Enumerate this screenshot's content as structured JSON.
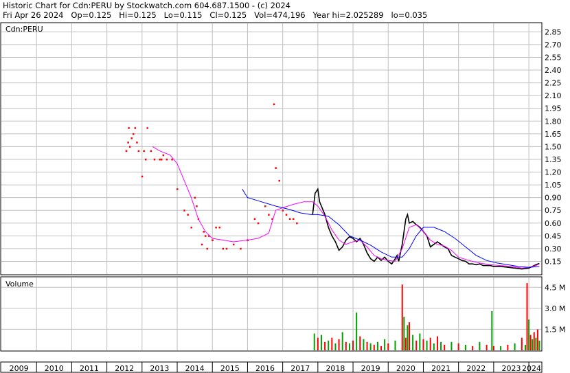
{
  "header": {
    "title": "Historic Chart for Cdn:PERU by Stockwatch.com 604.687.1500 - (c) 2024",
    "info": "Fri Apr 26 2024   Op=0.125   Hi=0.125   Lo=0.115   Cl=0.125   Vol=474,196   Year hi=2.025289   lo=0.035"
  },
  "chart_data": [
    {
      "type": "line",
      "panel": "price",
      "title": "Cdn:PERU",
      "y_tick_labels": [
        "2.85",
        "2.70",
        "2.55",
        "2.40",
        "2.25",
        "2.10",
        "1.95",
        "1.80",
        "1.65",
        "1.50",
        "1.35",
        "1.20",
        "1.05",
        "0.90",
        "0.75",
        "0.60",
        "0.45",
        "0.30",
        "0.15"
      ],
      "ylim": [
        0,
        2.95
      ],
      "xlim": [
        2009.0,
        2024.35
      ],
      "grid": true,
      "colors": {
        "price": "#000000",
        "close_dot": "#ff0000",
        "ma_short": "#ff00ff",
        "ma_long": "#0000ff",
        "grid": "#c0c0c0"
      },
      "series": [
        {
          "role": "price",
          "x": [
            2017.85,
            2017.92,
            2018.0,
            2018.05,
            2018.1,
            2018.2,
            2018.3,
            2018.4,
            2018.5,
            2018.6,
            2018.7,
            2018.8,
            2018.9,
            2019.0,
            2019.1,
            2019.2,
            2019.3,
            2019.4,
            2019.5,
            2019.6,
            2019.7,
            2019.8,
            2019.9,
            2020.0,
            2020.1,
            2020.2,
            2020.25,
            2020.3,
            2020.4,
            2020.5,
            2020.55,
            2020.6,
            2020.7,
            2020.8,
            2020.9,
            2021.0,
            2021.1,
            2021.2,
            2021.3,
            2021.4,
            2021.5,
            2021.6,
            2021.7,
            2021.8,
            2021.9,
            2022.0,
            2022.1,
            2022.2,
            2022.3,
            2022.4,
            2022.5,
            2022.6,
            2022.7,
            2022.8,
            2022.9,
            2023.0,
            2023.2,
            2023.4,
            2023.6,
            2023.8,
            2024.0,
            2024.1,
            2024.2,
            2024.3
          ],
          "y": [
            0.7,
            0.95,
            1.0,
            0.85,
            0.8,
            0.7,
            0.55,
            0.45,
            0.38,
            0.28,
            0.32,
            0.4,
            0.44,
            0.42,
            0.38,
            0.42,
            0.35,
            0.25,
            0.18,
            0.15,
            0.2,
            0.16,
            0.2,
            0.15,
            0.12,
            0.18,
            0.22,
            0.15,
            0.35,
            0.65,
            0.7,
            0.6,
            0.62,
            0.58,
            0.55,
            0.5,
            0.45,
            0.32,
            0.35,
            0.38,
            0.35,
            0.32,
            0.3,
            0.22,
            0.2,
            0.18,
            0.16,
            0.15,
            0.12,
            0.12,
            0.11,
            0.12,
            0.1,
            0.1,
            0.1,
            0.09,
            0.09,
            0.08,
            0.07,
            0.06,
            0.07,
            0.09,
            0.11,
            0.125
          ]
        },
        {
          "role": "close_dots",
          "x": [
            2012.55,
            2012.6,
            2012.62,
            2012.65,
            2012.7,
            2012.75,
            2012.8,
            2012.85,
            2012.9,
            2013.0,
            2013.05,
            2013.1,
            2013.15,
            2013.25,
            2013.35,
            2013.5,
            2013.55,
            2013.6,
            2013.7,
            2013.85,
            2014.0,
            2014.2,
            2014.3,
            2014.4,
            2014.5,
            2014.55,
            2014.6,
            2014.7,
            2014.75,
            2014.8,
            2014.85,
            2014.9,
            2015.0,
            2015.1,
            2015.2,
            2015.3,
            2015.4,
            2015.6,
            2015.8,
            2016.0,
            2016.2,
            2016.3,
            2016.5,
            2016.6,
            2016.7,
            2016.75,
            2016.8,
            2016.9,
            2017.0,
            2017.1,
            2017.2,
            2017.3,
            2017.4
          ],
          "y": [
            1.45,
            1.55,
            1.72,
            1.5,
            1.6,
            1.65,
            1.72,
            1.55,
            1.45,
            1.15,
            1.45,
            1.35,
            1.72,
            1.45,
            1.35,
            1.35,
            1.35,
            1.4,
            1.35,
            1.35,
            1.0,
            0.75,
            0.7,
            0.55,
            0.9,
            0.8,
            0.65,
            0.35,
            0.5,
            0.45,
            0.3,
            0.45,
            0.4,
            0.55,
            0.55,
            0.3,
            0.3,
            0.35,
            0.3,
            0.4,
            0.65,
            0.6,
            0.8,
            0.7,
            0.65,
            2.0,
            1.25,
            1.1,
            0.75,
            0.7,
            0.65,
            0.65,
            0.6
          ]
        },
        {
          "role": "ma_short",
          "x": [
            2013.3,
            2013.5,
            2013.8,
            2014.0,
            2014.2,
            2014.4,
            2014.6,
            2014.8,
            2015.0,
            2015.3,
            2015.6,
            2016.0,
            2016.3,
            2016.6,
            2016.8,
            2017.0,
            2017.3,
            2017.6,
            2017.85,
            2018.0,
            2018.2,
            2018.4,
            2018.6,
            2018.8,
            2019.0,
            2019.2,
            2019.4,
            2019.6,
            2019.8,
            2020.0,
            2020.2,
            2020.4,
            2020.6,
            2020.8,
            2021.0,
            2021.2,
            2021.4,
            2021.6,
            2021.8,
            2022.0,
            2022.3,
            2022.6,
            2022.9,
            2023.2,
            2023.5,
            2023.8,
            2024.0,
            2024.2,
            2024.3
          ],
          "y": [
            1.5,
            1.45,
            1.4,
            1.3,
            1.1,
            0.9,
            0.65,
            0.5,
            0.42,
            0.4,
            0.38,
            0.4,
            0.42,
            0.48,
            0.75,
            0.78,
            0.82,
            0.85,
            0.85,
            0.8,
            0.68,
            0.52,
            0.4,
            0.35,
            0.38,
            0.4,
            0.32,
            0.22,
            0.18,
            0.16,
            0.15,
            0.3,
            0.55,
            0.58,
            0.5,
            0.4,
            0.35,
            0.33,
            0.28,
            0.2,
            0.16,
            0.13,
            0.11,
            0.1,
            0.09,
            0.07,
            0.08,
            0.1,
            0.12
          ]
        },
        {
          "role": "ma_long",
          "x": [
            2015.85,
            2016.0,
            2016.4,
            2016.8,
            2017.2,
            2017.5,
            2017.8,
            2018.0,
            2018.3,
            2018.6,
            2018.9,
            2019.2,
            2019.5,
            2019.8,
            2020.1,
            2020.4,
            2020.6,
            2020.8,
            2021.0,
            2021.3,
            2021.6,
            2021.9,
            2022.2,
            2022.5,
            2022.8,
            2023.1,
            2023.4,
            2023.7,
            2024.0,
            2024.3
          ],
          "y": [
            1.0,
            0.9,
            0.85,
            0.8,
            0.76,
            0.72,
            0.7,
            0.7,
            0.68,
            0.58,
            0.45,
            0.4,
            0.34,
            0.26,
            0.2,
            0.2,
            0.3,
            0.45,
            0.55,
            0.55,
            0.5,
            0.42,
            0.32,
            0.22,
            0.16,
            0.13,
            0.11,
            0.09,
            0.08,
            0.09
          ]
        }
      ]
    },
    {
      "type": "bar",
      "panel": "volume",
      "title": "Volume",
      "y_tick_labels": [
        "4.5 M",
        "3.0 M",
        "1.5 M"
      ],
      "ylim": [
        0,
        5.2
      ],
      "xlim": [
        2009.0,
        2024.35
      ],
      "x_tick_labels": [
        "2009",
        "2010",
        "2011",
        "2012",
        "2013",
        "2014",
        "2015",
        "2016",
        "2017",
        "2018",
        "2019",
        "2020",
        "2021",
        "2022",
        "2023",
        "2024"
      ],
      "colors": {
        "up": "#00a000",
        "down": "#ff0000",
        "neutral": "#909090"
      },
      "series": [
        {
          "name": "Volume",
          "x": [
            2017.9,
            2018.0,
            2018.1,
            2018.2,
            2018.3,
            2018.4,
            2018.5,
            2018.6,
            2018.7,
            2018.8,
            2018.9,
            2019.0,
            2019.1,
            2019.2,
            2019.3,
            2019.4,
            2019.5,
            2019.6,
            2019.7,
            2019.8,
            2019.9,
            2020.0,
            2020.2,
            2020.4,
            2020.45,
            2020.5,
            2020.55,
            2020.6,
            2020.7,
            2020.8,
            2020.9,
            2021.0,
            2021.1,
            2021.2,
            2021.3,
            2021.4,
            2021.5,
            2021.6,
            2021.8,
            2022.0,
            2022.2,
            2022.4,
            2022.6,
            2022.8,
            2022.95,
            2023.0,
            2023.2,
            2023.4,
            2023.6,
            2023.8,
            2023.9,
            2023.95,
            2024.0,
            2024.05,
            2024.1,
            2024.15,
            2024.2,
            2024.25,
            2024.3
          ],
          "values": [
            1.2,
            0.9,
            1.1,
            0.6,
            0.7,
            0.9,
            0.5,
            0.8,
            1.3,
            0.6,
            0.5,
            0.7,
            2.7,
            1.0,
            0.8,
            0.6,
            0.5,
            0.4,
            0.6,
            0.3,
            0.8,
            0.5,
            0.7,
            4.7,
            2.4,
            0.9,
            1.8,
            2.0,
            1.1,
            0.7,
            1.2,
            0.8,
            0.7,
            0.9,
            0.5,
            1.0,
            0.6,
            0.4,
            0.6,
            0.5,
            0.4,
            0.3,
            0.6,
            0.4,
            2.8,
            0.3,
            0.3,
            0.4,
            0.5,
            0.9,
            0.4,
            4.8,
            2.2,
            1.1,
            0.8,
            1.3,
            0.9,
            1.5,
            0.7
          ]
        }
      ]
    }
  ]
}
